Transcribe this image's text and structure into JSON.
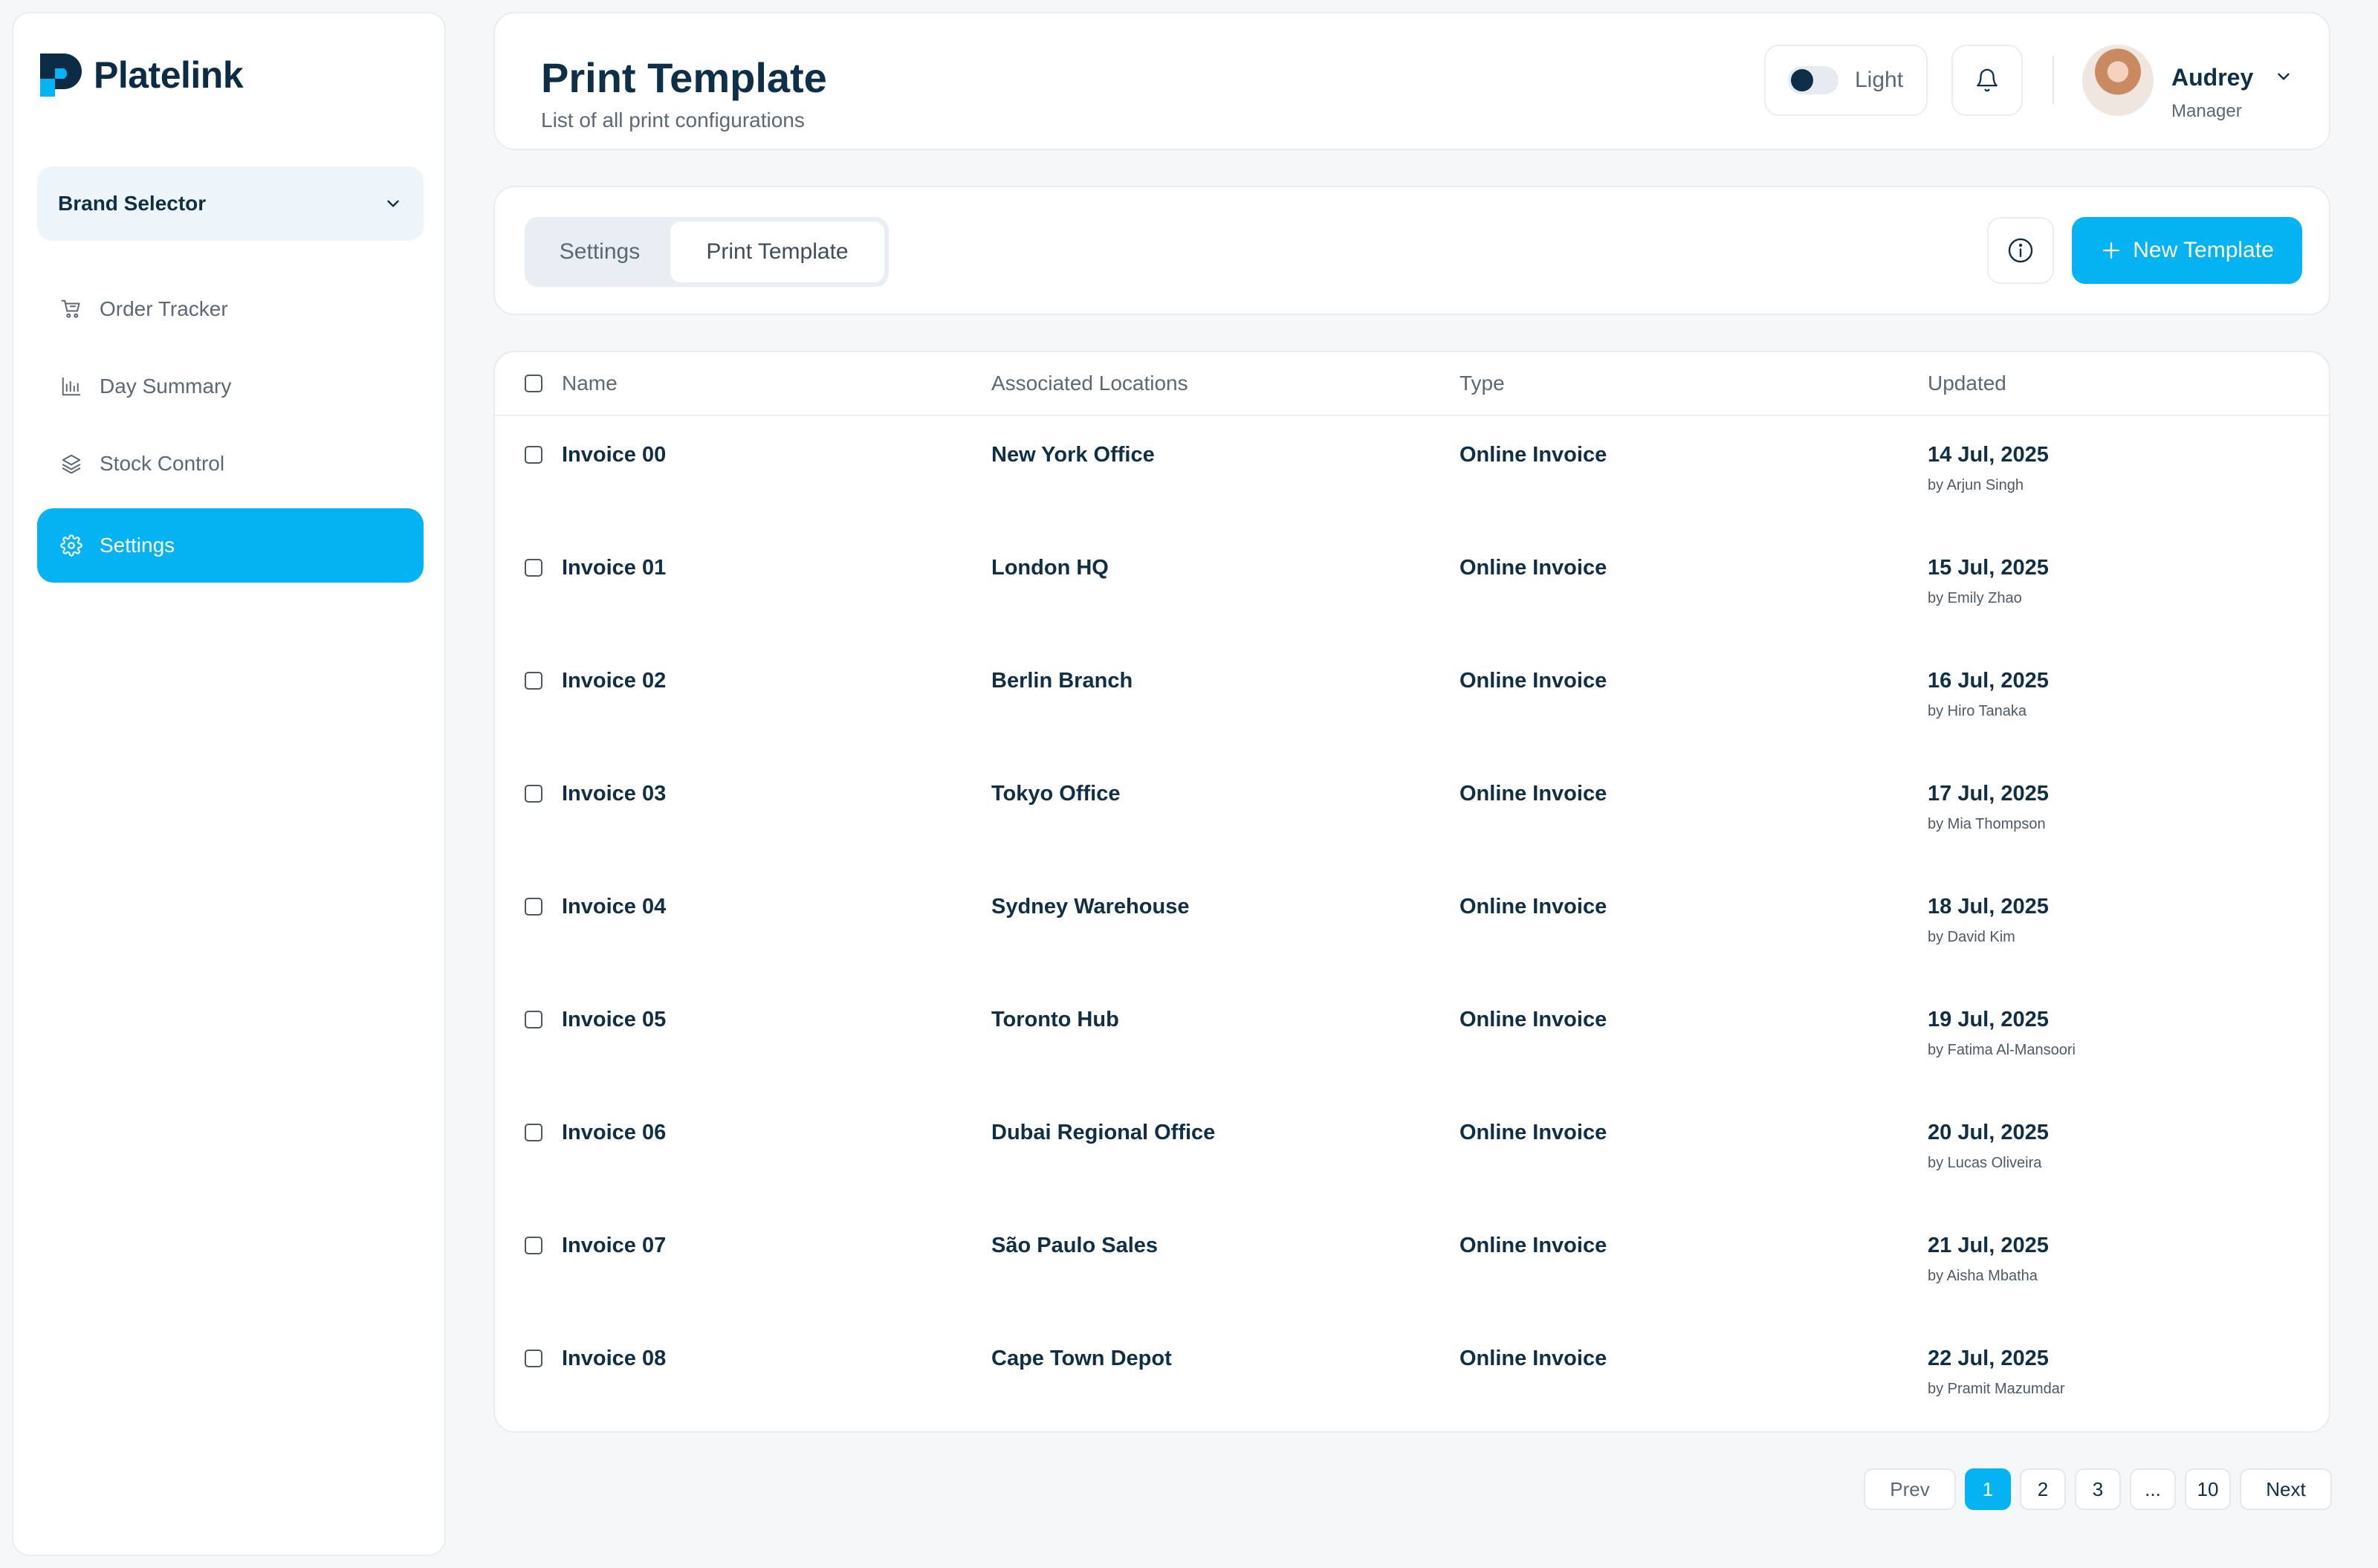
{
  "brand": {
    "name": "Platelink"
  },
  "sidebar": {
    "brand_selector": "Brand Selector",
    "items": [
      {
        "label": "Order Tracker",
        "icon": "cart-icon"
      },
      {
        "label": "Day Summary",
        "icon": "bar-chart-icon"
      },
      {
        "label": "Stock Control",
        "icon": "layers-icon"
      },
      {
        "label": "Settings",
        "icon": "gear-icon",
        "active": true
      }
    ]
  },
  "header": {
    "title": "Print Template",
    "subtitle": "List of all print configurations",
    "theme_label": "Light",
    "user": {
      "name": "Audrey",
      "role": "Manager"
    }
  },
  "toolbar": {
    "tabs": [
      "Settings",
      "Print Template"
    ],
    "active_tab": "Print Template",
    "new_button": "New Template"
  },
  "table": {
    "columns": [
      "Name",
      "Associated Locations",
      "Type",
      "Updated"
    ],
    "rows": [
      {
        "name": "Invoice 00",
        "location": "New York Office",
        "type": "Online Invoice",
        "date": "14 Jul, 2025",
        "by": "by Arjun Singh"
      },
      {
        "name": "Invoice 01",
        "location": "London HQ",
        "type": "Online Invoice",
        "date": "15 Jul, 2025",
        "by": "by Emily Zhao"
      },
      {
        "name": "Invoice 02",
        "location": "Berlin Branch",
        "type": "Online Invoice",
        "date": "16 Jul, 2025",
        "by": "by Hiro Tanaka"
      },
      {
        "name": "Invoice 03",
        "location": "Tokyo Office",
        "type": "Online Invoice",
        "date": "17 Jul, 2025",
        "by": "by Mia Thompson"
      },
      {
        "name": "Invoice 04",
        "location": "Sydney Warehouse",
        "type": "Online Invoice",
        "date": "18 Jul, 2025",
        "by": "by David Kim"
      },
      {
        "name": "Invoice 05",
        "location": "Toronto Hub",
        "type": "Online Invoice",
        "date": "19 Jul, 2025",
        "by": "by Fatima Al-Mansoori"
      },
      {
        "name": "Invoice 06",
        "location": "Dubai Regional Office",
        "type": "Online Invoice",
        "date": "20 Jul, 2025",
        "by": "by Lucas Oliveira"
      },
      {
        "name": "Invoice 07",
        "location": "São Paulo Sales",
        "type": "Online Invoice",
        "date": "21 Jul, 2025",
        "by": "by Aisha Mbatha"
      },
      {
        "name": "Invoice 08",
        "location": "Cape Town Depot",
        "type": "Online Invoice",
        "date": "22 Jul, 2025",
        "by": "by Pramit Mazumdar"
      }
    ]
  },
  "pagination": {
    "prev": "Prev",
    "next": "Next",
    "pages": [
      "1",
      "2",
      "3",
      "...",
      "10"
    ],
    "current": "1"
  },
  "colors": {
    "accent": "#05b2f2",
    "text": "#0f2f46",
    "muted": "#5b6875"
  }
}
